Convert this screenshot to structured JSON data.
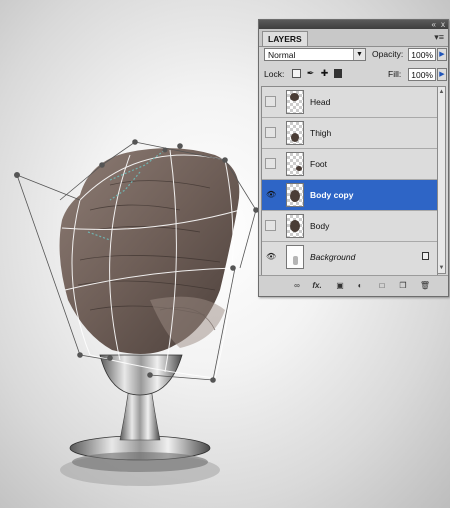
{
  "panel": {
    "tab_title": "LAYERS",
    "collapse_icon": "«",
    "close_icon": "x",
    "menu_icon": "menu-icon",
    "blend_mode": "Normal",
    "opacity_label": "Opacity:",
    "opacity_value": "100%",
    "lock_label": "Lock:",
    "fill_label": "Fill:",
    "fill_value": "100%",
    "layers": [
      {
        "name": "Head",
        "visible": false,
        "selected": false
      },
      {
        "name": "Thigh",
        "visible": false,
        "selected": false
      },
      {
        "name": "Foot",
        "visible": false,
        "selected": false
      },
      {
        "name": "Body copy",
        "visible": true,
        "selected": true
      },
      {
        "name": "Body",
        "visible": false,
        "selected": false
      },
      {
        "name": "Background",
        "visible": true,
        "selected": false,
        "locked": true
      }
    ],
    "bottom_tools": [
      "link-icon",
      "fx-icon",
      "mask-icon",
      "adjustment-icon",
      "group-icon",
      "new-layer-icon",
      "trash-icon"
    ],
    "fx_label": "fx."
  },
  "colors": {
    "selection": "#2e65c6",
    "panel_bg": "#d4d4d4"
  }
}
